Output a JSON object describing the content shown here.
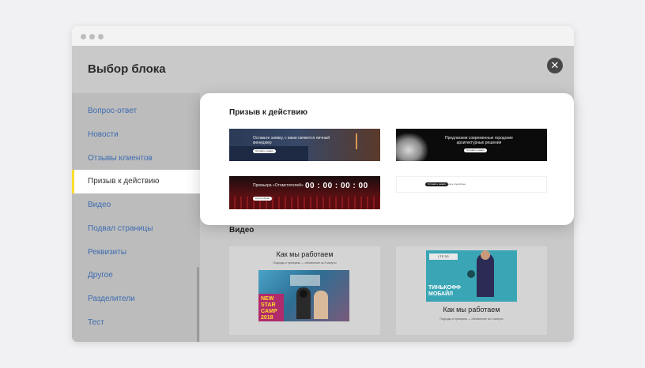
{
  "modal": {
    "title": "Выбор блока"
  },
  "sidebar": {
    "items": [
      {
        "label": "Вопрос-ответ"
      },
      {
        "label": "Новости"
      },
      {
        "label": "Отзывы клиентов"
      },
      {
        "label": "Призыв к действию"
      },
      {
        "label": "Видео"
      },
      {
        "label": "Подвал страницы"
      },
      {
        "label": "Реквизиты"
      },
      {
        "label": "Другое"
      },
      {
        "label": "Разделители"
      },
      {
        "label": "Тест"
      }
    ],
    "active_index": 3
  },
  "sections": {
    "cta": {
      "title": "Призыв к действию",
      "thumbs": [
        {
          "text": "Оставьте заявку, с вами свяжется личный менеджер",
          "button": "Оставить заявку"
        },
        {
          "text": "Предлагаем современные городские архитектурные решения",
          "button": "Оставить заявку"
        },
        {
          "text": "Премьера «Отомстителей»",
          "timer": "00 : 00 : 00 : 00",
          "button": "Купить билет"
        },
        {
          "button": "Оставить заявку",
          "link": "Узнать подробнее"
        }
      ]
    },
    "video": {
      "title": "Видео",
      "cards": [
        {
          "heading": "Как мы работаем",
          "sub": "Подходы и принципы — обновление за 2 минуты",
          "caption": "NEW STAR CAMP 2018"
        },
        {
          "heading": "Как мы работаем",
          "sub": "Подходы и принципы — обновление за 2 минуты",
          "caption": "ТИНЬКОФФ МОБАЙЛ",
          "badge": "LTE 3G"
        }
      ]
    }
  },
  "colors": {
    "accent_yellow": "#ffdd2d",
    "link_blue": "#3d6bb0"
  }
}
